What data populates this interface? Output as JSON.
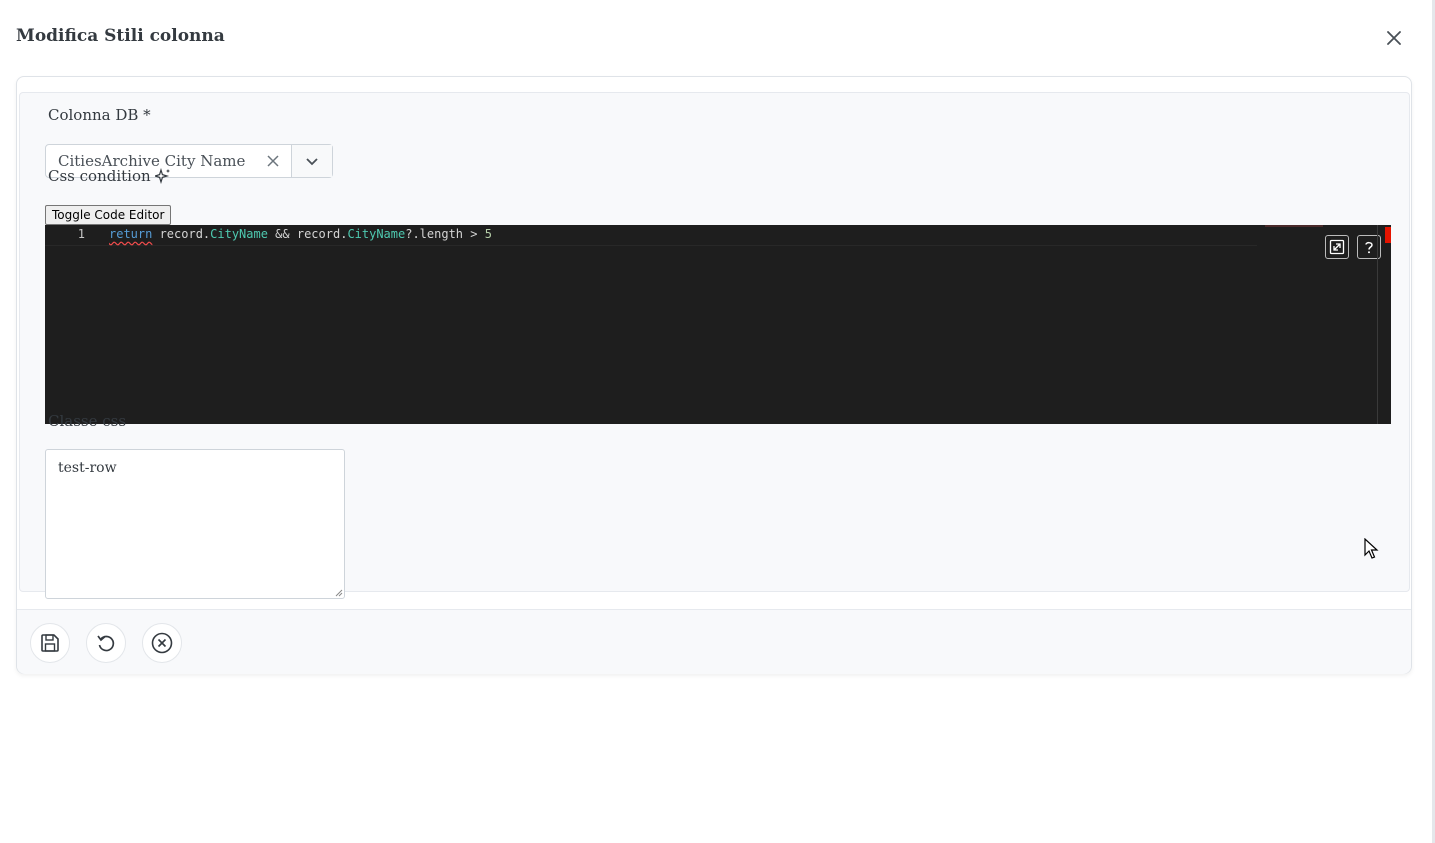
{
  "dialog": {
    "title": "Modifica Stili colonna",
    "close_icon": "close-icon"
  },
  "form": {
    "db_column": {
      "label": "Colonna DB *",
      "value": "CitiesArchive City Name",
      "clear_icon": "clear-icon",
      "dropdown_icon": "chevron-down-icon"
    },
    "css_condition": {
      "label": "Css condition",
      "ai_icon": "sparkles-icon",
      "toggle_label": "Toggle Code Editor",
      "line_number": "1",
      "code": {
        "kw": "return",
        "p1": " record.",
        "prop1": "CityName",
        "p2": " && record.",
        "prop2": "CityName",
        "p3": "?.length > ",
        "num": "5"
      },
      "tools": [
        "expand-icon",
        "help-icon"
      ]
    },
    "css_class": {
      "label": "Classe css",
      "value": "test-row"
    }
  },
  "footer": {
    "buttons": [
      "save-icon",
      "undo-icon",
      "cancel-circle-icon"
    ]
  },
  "colors": {
    "editor_bg": "#1e1e1e",
    "keyword": "#569cd6",
    "property": "#4ec9b0",
    "number": "#b5cea8",
    "error": "#e51400"
  }
}
